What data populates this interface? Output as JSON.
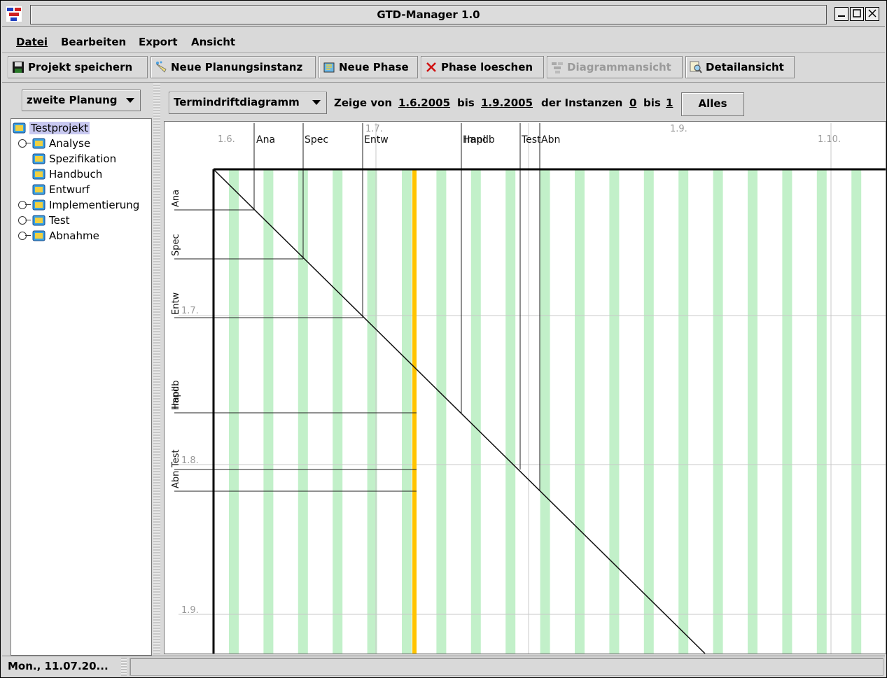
{
  "window": {
    "title": "GTD-Manager 1.0"
  },
  "menu": [
    "Datei",
    "Bearbeiten",
    "Export",
    "Ansicht"
  ],
  "toolbar": {
    "save": "Projekt speichern",
    "new_instance": "Neue Planungsinstanz",
    "new_phase": "Neue Phase",
    "delete_phase": "Phase loeschen",
    "diagram_view": "Diagrammansicht",
    "detail_view": "Detailansicht"
  },
  "planning": {
    "selected": "zweite Planung"
  },
  "tree": {
    "root": "Testprojekt",
    "children": [
      "Analyse",
      "Spezifikation",
      "Handbuch",
      "Entwurf",
      "Implementierung",
      "Test",
      "Abnahme"
    ]
  },
  "controls": {
    "diagram_type": "Termindriftdiagramm",
    "show_from": "Zeige von",
    "date_from": "1.6.2005",
    "to": "bis",
    "date_to": "1.9.2005",
    "of_instances": "der Instanzen",
    "inst_from": "0",
    "to2": "bis",
    "inst_to": "1",
    "all_button": "Alles"
  },
  "chart_data": {
    "type": "line",
    "x_date_ticks": [
      "1.6.",
      "1.7.",
      "1.9.",
      "1.10."
    ],
    "y_date_ticks": [
      "1.7.",
      "1.8.",
      "1.9."
    ],
    "x_phase_labels": [
      "Ana",
      "Spec",
      "Entw",
      "Handb",
      "Impl",
      "Test",
      "Abn"
    ],
    "y_phase_labels": [
      "Ana",
      "Spec",
      "Entw",
      "Handb",
      "Impl",
      "Test",
      "Abn"
    ],
    "colors": {
      "weekend": "#c2f0c9",
      "today": "#ffc400",
      "line": "#000000"
    }
  },
  "status": {
    "date": "Mon., 11.07.20..."
  }
}
